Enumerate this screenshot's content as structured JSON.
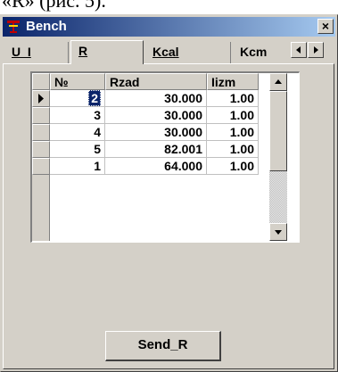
{
  "caption_fragment": "«R» (рис. 5).",
  "window": {
    "title": "Bench",
    "close_glyph": "×"
  },
  "tabs": [
    {
      "label": "U_I",
      "active": false
    },
    {
      "label": "R",
      "active": true
    },
    {
      "label": "Kcal",
      "active": false
    },
    {
      "label": "Kcm",
      "active": false
    }
  ],
  "tab_scroll": {
    "left_icon": "triangle-left-icon",
    "right_icon": "triangle-right-icon"
  },
  "grid": {
    "columns": [
      "№",
      "Rzad",
      "Iizm"
    ],
    "rows": [
      {
        "n": "2",
        "rzad": "30.000",
        "iizm": "1.00",
        "current": true
      },
      {
        "n": "3",
        "rzad": "30.000",
        "iizm": "1.00",
        "current": false
      },
      {
        "n": "4",
        "rzad": "30.000",
        "iizm": "1.00",
        "current": false
      },
      {
        "n": "5",
        "rzad": "82.001",
        "iizm": "1.00",
        "current": false
      },
      {
        "n": "1",
        "rzad": "64.000",
        "iizm": "1.00",
        "current": false
      }
    ],
    "current_row_icon": "row-pointer-icon"
  },
  "send_button": {
    "label": "Send_R"
  },
  "colors": {
    "title_start": "#0a246a",
    "title_end": "#a6caf0",
    "face": "#d4d0c8",
    "selection": "#0a246a"
  }
}
